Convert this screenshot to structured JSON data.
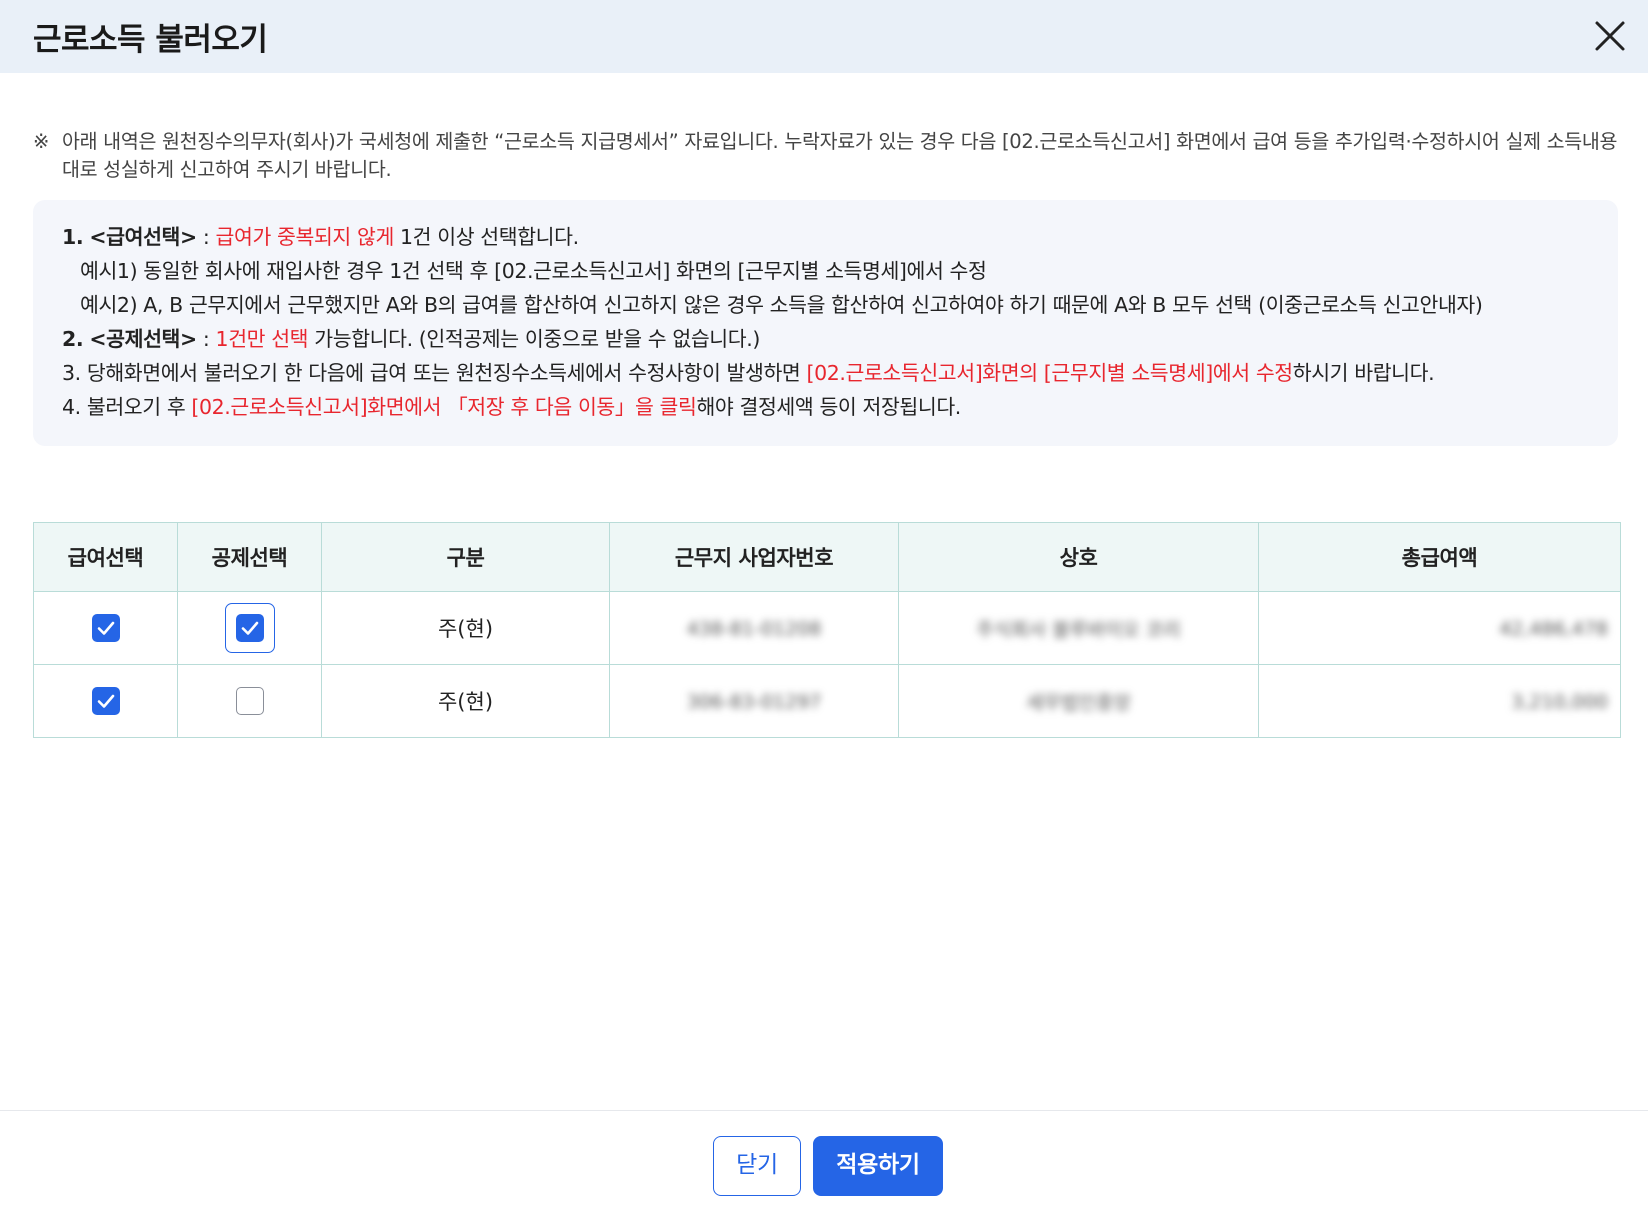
{
  "header": {
    "title": "근로소득 불러오기",
    "close_icon": "close-icon"
  },
  "notice": {
    "mark": "※",
    "text": "아래 내역은 원천징수의무자(회사)가 국세청에 제출한 “근로소득 지급명세서” 자료입니다. 누락자료가 있는 경우 다음 [02.근로소득신고서] 화면에서 급여 등을 추가입력·수정하시어 실제 소득내용대로 성실하게 신고하여 주시기 바랍니다."
  },
  "guide": {
    "item1": {
      "num": "1.",
      "title": "<급여선택>",
      "sep": " : ",
      "red": "급여가 중복되지 않게",
      "rest": " 1건 이상 선택합니다."
    },
    "example1": "예시1) 동일한 회사에 재입사한 경우 1건 선택 후 [02.근로소득신고서] 화면의 [근무지별 소득명세]에서 수정",
    "example2": "예시2) A, B 근무지에서 근무했지만 A와 B의 급여를 합산하여 신고하지 않은 경우 소득을 합산하여 신고하여야 하기 때문에 A와 B 모두 선택 (이중근로소득 신고안내자)",
    "item2": {
      "num": "2.",
      "title": "<공제선택>",
      "sep": " : ",
      "red": "1건만 선택",
      "rest": " 가능합니다. (인적공제는 이중으로 받을 수 없습니다.)"
    },
    "item3": {
      "pre": "3. 당해화면에서 불러오기 한 다음에 급여 또는 원천징수소득세에서 수정사항이 발생하면 ",
      "red": "[02.근로소득신고서]화면의 [근무지별 소득명세]에서 수정",
      "rest": "하시기 바랍니다."
    },
    "item4": {
      "pre": "4. 불러오기 후 ",
      "red": "[02.근로소득신고서]화면에서 「저장 후 다음 이동」을 클릭",
      "rest": "해야 결정세액 등이 저장됩니다."
    }
  },
  "table": {
    "headers": [
      "급여선택",
      "공제선택",
      "구분",
      "근무지 사업자번호",
      "상호",
      "총급여액"
    ],
    "rows": [
      {
        "salary_checked": true,
        "deduction_checked": true,
        "type": "주(현)",
        "biz_no": "438-81-01208",
        "company": "주식회사 블루바이오 코리",
        "total": "42,486,478"
      },
      {
        "salary_checked": true,
        "deduction_checked": false,
        "type": "주(현)",
        "biz_no": "306-83-01297",
        "company": "세무법인중앙",
        "total": "3,210,000"
      }
    ]
  },
  "footer": {
    "close_label": "닫기",
    "apply_label": "적용하기"
  },
  "colors": {
    "accent": "#2565e6",
    "highlight_red": "#e8262e",
    "header_bg": "#e9f0f8",
    "table_header_bg": "#eef7f6"
  }
}
